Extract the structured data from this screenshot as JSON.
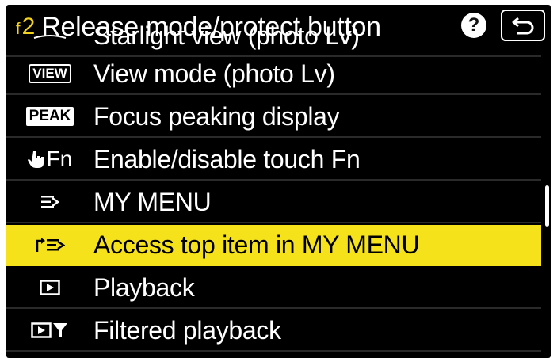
{
  "header": {
    "menu_code": "2",
    "menu_prefix": "f",
    "title": "Release mode/protect button"
  },
  "menu_items": [
    {
      "icon": "starlight-view-icon",
      "label": "Starlight view (photo Lv)"
    },
    {
      "icon": "view-icon",
      "icon_text": "VIEW",
      "label": "View mode (photo Lv)"
    },
    {
      "icon": "peak-icon",
      "icon_text": "PEAK",
      "label": "Focus peaking display"
    },
    {
      "icon": "touch-fn-icon",
      "icon_text": "Fn",
      "label": "Enable/disable touch Fn"
    },
    {
      "icon": "my-menu-icon",
      "label": "MY MENU"
    },
    {
      "icon": "my-menu-top-item-icon",
      "label": "Access top item in MY MENU",
      "selected": true
    },
    {
      "icon": "playback-icon",
      "label": "Playback"
    },
    {
      "icon": "filtered-playback-icon",
      "label": "Filtered playback"
    }
  ],
  "colors": {
    "highlight": "#f5e21b",
    "background": "#000000",
    "menu_code": "#f2d21c"
  }
}
